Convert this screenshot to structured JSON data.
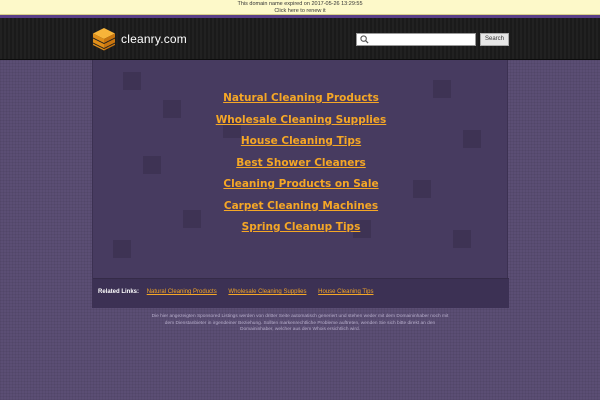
{
  "notice": {
    "line1": "This domain name expired on 2017-05-26 13:29:55",
    "line2": "Click here to renew it"
  },
  "header": {
    "logo_text": "cleanry.com",
    "search_placeholder": "",
    "search_button": "Search"
  },
  "main": {
    "links": [
      "Natural Cleaning Products",
      "Wholesale Cleaning Supplies",
      "House Cleaning Tips",
      "Best Shower Cleaners",
      "Cleaning Products on Sale",
      "Carpet Cleaning Machines",
      "Spring Cleanup Tips"
    ]
  },
  "related": {
    "label": "Related Links:",
    "links": [
      "Natural Cleaning Products",
      "Wholesale Cleaning Supplies",
      "House Cleaning Tips"
    ]
  },
  "footer": {
    "disclaimer": "Die hier angezeigten Sponsored Listings werden von dritter Seite automatisch generiert und stehen weder mit dem Domaininhaber noch mit dem Dienstanbieter in irgendeiner Beziehung. Sollten markenrechtliche Probleme auftreten, wenden Sie sich bitte direkt an den Domaininhaber, welcher aus dem Whois ersichtlich wird."
  },
  "colors": {
    "link_orange": "#f5a726",
    "page_purple": "#5b4e74",
    "panel_purple": "#473b60",
    "header_dark": "#1a1a1a"
  }
}
